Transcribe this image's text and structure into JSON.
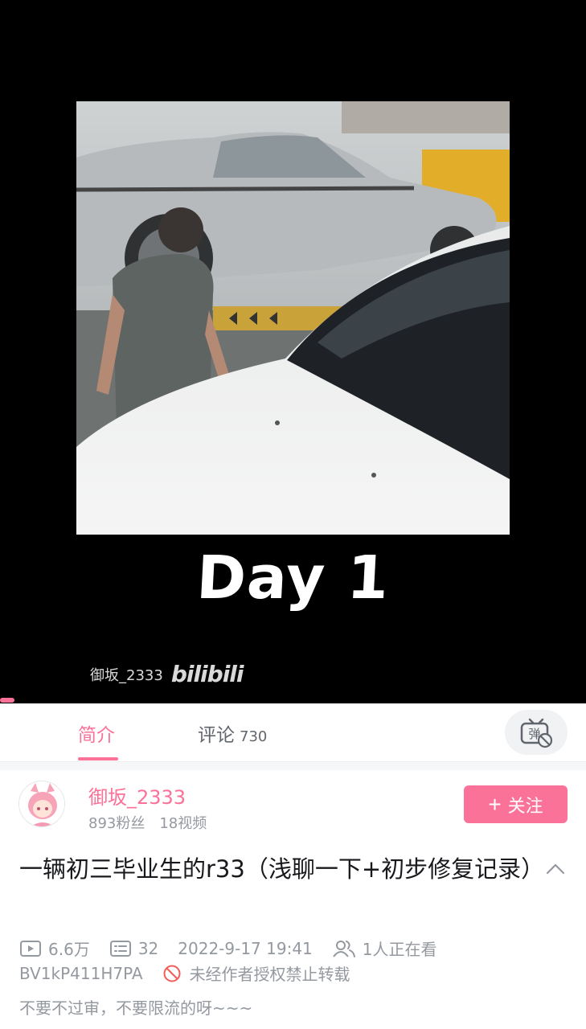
{
  "player": {
    "overlay_text": "Day 1",
    "watermark_user": "御坂_2333",
    "watermark_logo": "bilibili"
  },
  "tabs": [
    {
      "label": "简介",
      "active": true
    },
    {
      "label": "评论",
      "count": "730"
    }
  ],
  "danmaku_toggle": {
    "icon": "danmaku-off-icon",
    "glyph": "弹"
  },
  "uploader": {
    "name": "御坂_2333",
    "fans": "893粉丝",
    "videos": "18视频",
    "follow_label": "关注"
  },
  "video": {
    "title": "一辆初三毕业生的r33（浅聊一下+初步修复记录）",
    "views": "6.6万",
    "danmaku_count": "32",
    "published": "2022-9-17 19:41",
    "watching": "1人正在看",
    "bvid": "BV1kP411H7PA",
    "reprint_notice": "未经作者授权禁止转载",
    "description": "不要不过审，不要限流的呀~~~"
  },
  "colors": {
    "accent": "#fb7299",
    "muted": "#9499a0",
    "text": "#18191c"
  }
}
